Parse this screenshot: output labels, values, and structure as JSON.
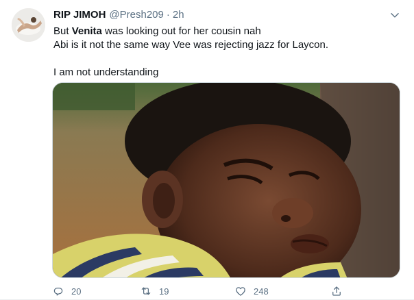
{
  "tweet": {
    "display_name": "RIP JIMOH",
    "handle": "@Presh209",
    "separator": "·",
    "time": "2h",
    "lines": {
      "line1_prefix": "But ",
      "line1_bold": "Venita",
      "line1_suffix": " was looking out for her cousin nah",
      "line2": "Abi is it not the same way Vee was rejecting jazz for Laycon.",
      "line3": "I am not understanding"
    }
  },
  "actions": {
    "reply_count": "20",
    "retweet_count": "19",
    "like_count": "248"
  },
  "icons": {
    "caret": "chevron-down-icon",
    "reply": "reply-icon",
    "retweet": "retweet-icon",
    "like": "heart-icon",
    "share": "share-icon"
  },
  "colors": {
    "secondary_text": "#5b7083",
    "primary_text": "#0f1419"
  }
}
